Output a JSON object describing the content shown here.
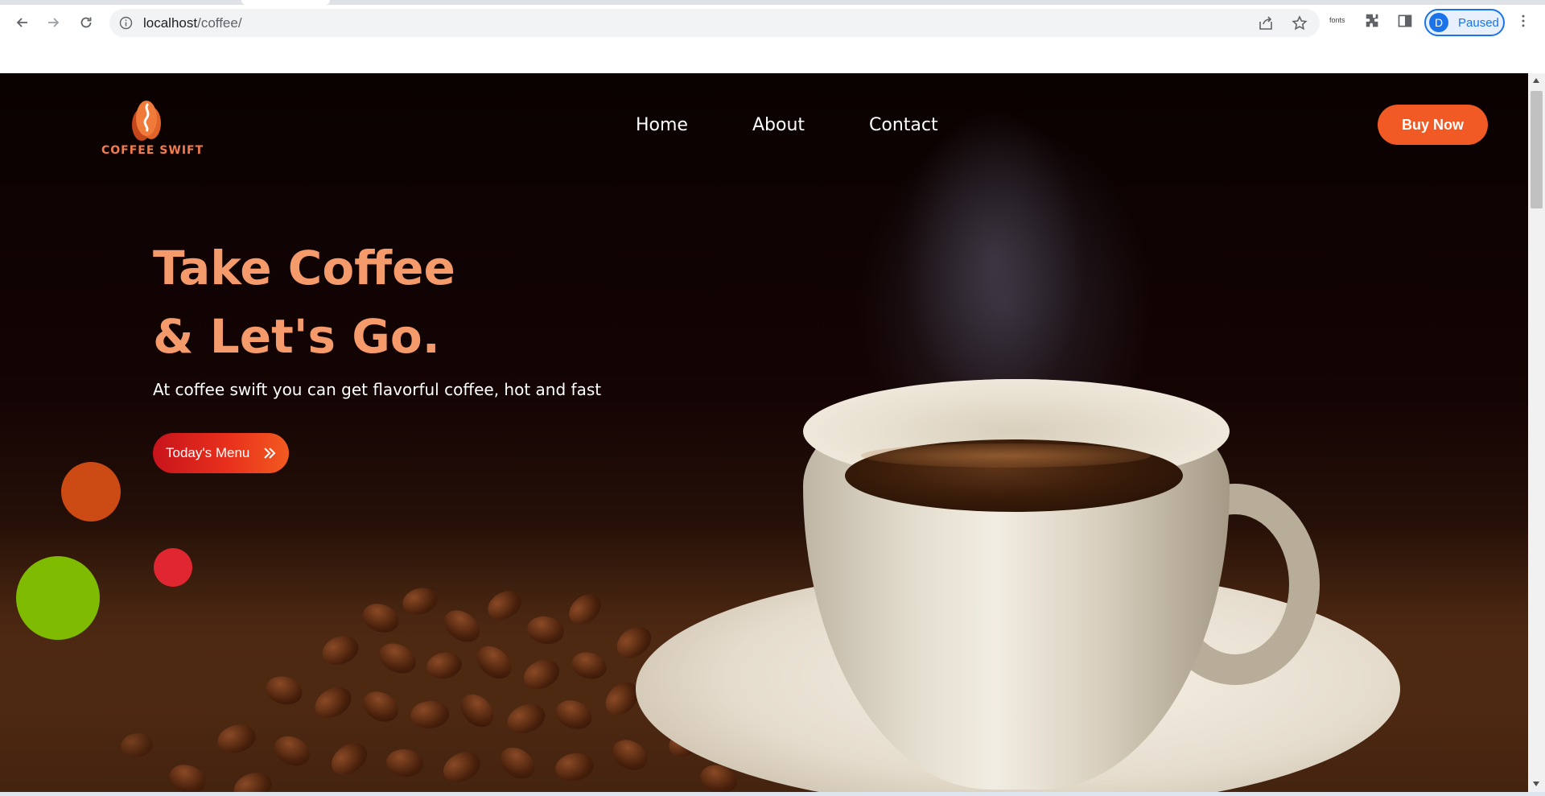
{
  "browser": {
    "url_host": "localhost",
    "url_path": "/coffee/",
    "extension_label": "fonts",
    "profile_initial": "D",
    "profile_status": "Paused"
  },
  "site": {
    "brand": "COFFEE SWIFT",
    "nav": [
      {
        "label": "Home"
      },
      {
        "label": "About"
      },
      {
        "label": "Contact"
      }
    ],
    "buy_button": "Buy Now"
  },
  "hero": {
    "headline_line1": "Take Coffee",
    "headline_line2": "& Let's Go.",
    "subtext": "At coffee swift you can get flavorful coffee, hot and fast",
    "menu_button": "Today's Menu",
    "menu_button_icon": "double-chevron-right-icon"
  },
  "colors": {
    "accent_orange": "#f15a24",
    "headline_peach": "#f49a6b",
    "dot_orange": "#cc4a14",
    "dot_red": "#e02630",
    "dot_green": "#7fbb00",
    "profile_blue": "#1a73e8"
  }
}
